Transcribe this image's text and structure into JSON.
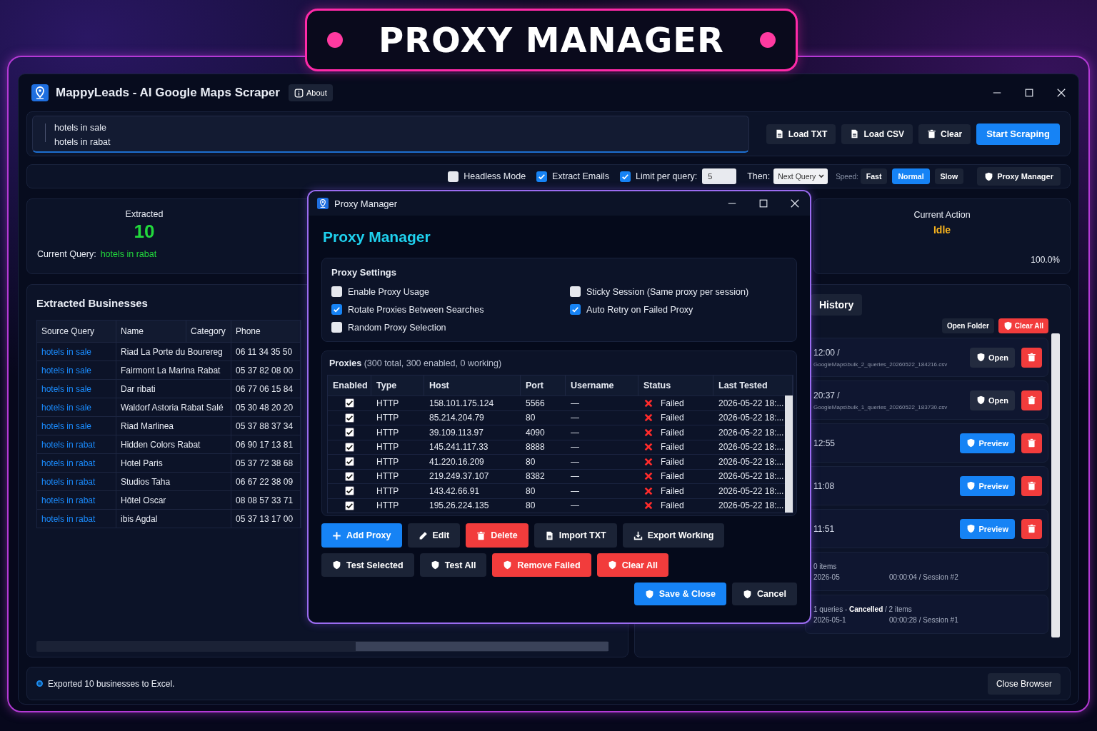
{
  "banner": {
    "title": "PROXY MANAGER"
  },
  "window": {
    "title": "MappyLeads - AI Google Maps Scraper",
    "about": "About"
  },
  "queries": {
    "lines": [
      "hotels in sale",
      "hotels in rabat"
    ]
  },
  "query_buttons": [
    {
      "label": "Load TXT",
      "kind": "plain"
    },
    {
      "label": "Load CSV",
      "kind": "plain"
    },
    {
      "label": "Clear",
      "kind": "plain"
    },
    {
      "label": "Start Scraping",
      "kind": "primary"
    }
  ],
  "options": {
    "headless": {
      "label": "Headless Mode",
      "checked": false
    },
    "extract_emails": {
      "label": "Extract Emails",
      "checked": true
    },
    "limit": {
      "label": "Limit per query:",
      "checked": true,
      "value": "5"
    },
    "then": {
      "label": "Then:",
      "value": "Next Query"
    },
    "speed": {
      "label": "Speed:",
      "options": [
        {
          "label": "Fast",
          "selected": false
        },
        {
          "label": "Normal",
          "selected": true
        },
        {
          "label": "Slow",
          "selected": false
        }
      ]
    },
    "proxy_button": "Proxy Manager"
  },
  "stats": {
    "extracted_label": "Extracted",
    "extracted": "10",
    "current_query_label": "Current Query:",
    "current_query": "hotels in rabat",
    "action_label": "Current Action",
    "action": "Idle",
    "progress": "100.0%"
  },
  "businesses": {
    "title": "Extracted Businesses",
    "columns": [
      "Source Query",
      "Name",
      "Category",
      "Phone"
    ],
    "rows": [
      {
        "source_query": "hotels in sale",
        "name": "Riad La Porte du Bourereg",
        "phone": "06 11 34 35 50"
      },
      {
        "source_query": "hotels in sale",
        "name": "Fairmont La Marina Rabat",
        "phone": "05 37 82 08 00"
      },
      {
        "source_query": "hotels in sale",
        "name": "Dar ribati",
        "phone": "06 77 06 15 84"
      },
      {
        "source_query": "hotels in sale",
        "name": "Waldorf Astoria Rabat Salé",
        "phone": "05 30 48 20 20"
      },
      {
        "source_query": "hotels in sale",
        "name": "Riad Marlinea",
        "phone": "05 37 88 37 34"
      },
      {
        "source_query": "hotels in rabat",
        "name": "Hidden Colors Rabat",
        "phone": "06 90 17 13 81"
      },
      {
        "source_query": "hotels in rabat",
        "name": "Hotel Paris",
        "phone": "05 37 72 38 68"
      },
      {
        "source_query": "hotels in rabat",
        "name": "Studios Taha",
        "phone": "06 67 22 38 09"
      },
      {
        "source_query": "hotels in rabat",
        "name": "Hôtel Oscar",
        "phone": "08 08 57 33 71"
      },
      {
        "source_query": "hotels in rabat",
        "name": "ibis Agdal",
        "phone": "05 37 13 17 00"
      }
    ]
  },
  "history": {
    "tab": "History",
    "buttons": [
      {
        "label": "Open Folder",
        "kind": "plain"
      },
      {
        "label": "Clear All",
        "kind": "danger"
      }
    ],
    "items": [
      {
        "kind": "file",
        "time": "12:00 /",
        "path": "GoogleMaps\\bulk_2_queries_20260522_184216.csv",
        "action": "Open"
      },
      {
        "kind": "file",
        "time": "20:37 /",
        "path": "GoogleMaps\\bulk_1_queries_20260522_183730.csv",
        "action": "Open"
      },
      {
        "kind": "preview",
        "time": "12:55",
        "action": "Preview"
      },
      {
        "kind": "preview",
        "time": "11:08",
        "action": "Preview"
      },
      {
        "kind": "preview",
        "time": "11:51",
        "action": "Preview"
      },
      {
        "kind": "session",
        "summary": "0 items",
        "duration": "00:00:04 / Session #2",
        "date": "2026-05"
      },
      {
        "kind": "session",
        "summary": "1 queries - **Cancelled** / 2 items",
        "duration": "00:00:28 / Session #1",
        "date": "2026-05-1"
      }
    ]
  },
  "status_bar": {
    "message": "Exported 10 businesses to Excel.",
    "button": "Close Browser"
  },
  "dialog": {
    "title": "Proxy Manager",
    "heading": "Proxy Manager",
    "settings": {
      "title": "Proxy Settings",
      "options": [
        {
          "label": "Enable Proxy Usage",
          "checked": false
        },
        {
          "label": "Sticky Session (Same proxy per session)",
          "checked": false
        },
        {
          "label": "Rotate Proxies Between Searches",
          "checked": true
        },
        {
          "label": "Auto Retry on Failed Proxy",
          "checked": true
        },
        {
          "label": "Random Proxy Selection",
          "checked": false
        }
      ]
    },
    "proxies": {
      "title": "Proxies",
      "summary": "(300 total, 300 enabled, 0 working)",
      "columns": [
        "Enabled",
        "Type",
        "Host",
        "Port",
        "Username",
        "Status",
        "Last Tested"
      ],
      "rows": [
        {
          "enabled": true,
          "type": "HTTP",
          "host": "158.101.175.124",
          "port": "5566",
          "username": "—",
          "working": false,
          "status": "Failed",
          "last_tested": "2026-05-22 18:..."
        },
        {
          "enabled": true,
          "type": "HTTP",
          "host": "85.214.204.79",
          "port": "80",
          "username": "—",
          "working": false,
          "status": "Failed",
          "last_tested": "2026-05-22 18:..."
        },
        {
          "enabled": true,
          "type": "HTTP",
          "host": "39.109.113.97",
          "port": "4090",
          "username": "—",
          "working": false,
          "status": "Failed",
          "last_tested": "2026-05-22 18:..."
        },
        {
          "enabled": true,
          "type": "HTTP",
          "host": "145.241.117.33",
          "port": "8888",
          "username": "—",
          "working": false,
          "status": "Failed",
          "last_tested": "2026-05-22 18:..."
        },
        {
          "enabled": true,
          "type": "HTTP",
          "host": "41.220.16.209",
          "port": "80",
          "username": "—",
          "working": false,
          "status": "Failed",
          "last_tested": "2026-05-22 18:..."
        },
        {
          "enabled": true,
          "type": "HTTP",
          "host": "219.249.37.107",
          "port": "8382",
          "username": "—",
          "working": false,
          "status": "Failed",
          "last_tested": "2026-05-22 18:..."
        },
        {
          "enabled": true,
          "type": "HTTP",
          "host": "143.42.66.91",
          "port": "80",
          "username": "—",
          "working": false,
          "status": "Failed",
          "last_tested": "2026-05-22 18:..."
        },
        {
          "enabled": true,
          "type": "HTTP",
          "host": "195.26.224.135",
          "port": "80",
          "username": "—",
          "working": false,
          "status": "Failed",
          "last_tested": "2026-05-22 18:..."
        }
      ]
    },
    "actions": [
      {
        "label": "Add Proxy",
        "kind": "primary"
      },
      {
        "label": "Edit",
        "kind": "plain"
      },
      {
        "label": "Delete",
        "kind": "danger"
      },
      {
        "label": "Import TXT",
        "kind": "plain"
      },
      {
        "label": "Export Working",
        "kind": "plain"
      }
    ],
    "tests": [
      {
        "label": "Test Selected",
        "kind": "plain"
      },
      {
        "label": "Test All",
        "kind": "plain"
      },
      {
        "label": "Remove Failed",
        "kind": "danger"
      },
      {
        "label": "Clear All",
        "kind": "danger"
      }
    ],
    "footer": [
      {
        "label": "Save & Close",
        "kind": "primary"
      },
      {
        "label": "Cancel",
        "kind": "plain"
      }
    ]
  }
}
